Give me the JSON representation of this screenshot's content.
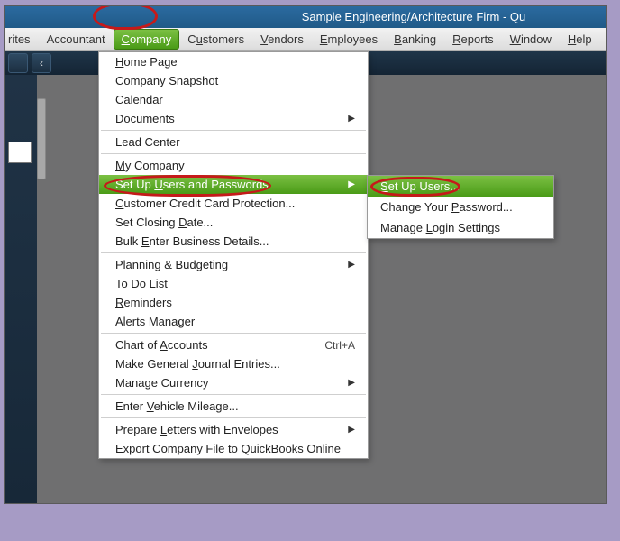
{
  "titlebar": {
    "text": "Sample Engineering/Architecture Firm  - Qu"
  },
  "menubar": {
    "partial_left": "rites",
    "items": [
      "Accountant",
      "Company",
      "Customers",
      "Vendors",
      "Employees",
      "Banking",
      "Reports",
      "Window",
      "Help"
    ],
    "underline_idx": [
      null,
      0,
      1,
      0,
      0,
      0,
      0,
      0,
      0
    ]
  },
  "subbar": {
    "back": "‹"
  },
  "company_menu": {
    "groups": [
      [
        {
          "label": "Home Page",
          "u": 0
        },
        {
          "label": "Company Snapshot"
        },
        {
          "label": "Calendar"
        },
        {
          "label": "Documents",
          "submenu": true
        }
      ],
      [
        {
          "label": "Lead Center"
        }
      ],
      [
        {
          "label": "My Company",
          "u": 0
        },
        {
          "label": "Set Up Users and Passwords",
          "u": 7,
          "submenu": true,
          "highlight": true
        },
        {
          "label": "Customer Credit Card Protection...",
          "u": 0
        },
        {
          "label": "Set Closing Date...",
          "u": 12
        },
        {
          "label": "Bulk Enter Business Details...",
          "u": 5
        }
      ],
      [
        {
          "label": "Planning & Budgeting",
          "submenu": true
        },
        {
          "label": "To Do List",
          "u": 0
        },
        {
          "label": "Reminders",
          "u": 0
        },
        {
          "label": "Alerts Manager"
        }
      ],
      [
        {
          "label": "Chart of Accounts",
          "u": 9,
          "shortcut": "Ctrl+A"
        },
        {
          "label": "Make General Journal Entries...",
          "u": 13
        },
        {
          "label": "Manage Currency",
          "submenu": true
        }
      ],
      [
        {
          "label": "Enter Vehicle Mileage...",
          "u": 6
        }
      ],
      [
        {
          "label": "Prepare Letters with Envelopes",
          "u": 8,
          "submenu": true
        },
        {
          "label": "Export Company File to QuickBooks Online"
        }
      ]
    ]
  },
  "sub_menu": {
    "items": [
      {
        "label": "Set Up Users...",
        "u": 0,
        "highlight": true
      },
      {
        "label": "Change Your Password...",
        "u": 12
      },
      {
        "label": "Manage Login Settings",
        "u": 7
      }
    ]
  },
  "icons": {
    "arrow": "▶"
  }
}
